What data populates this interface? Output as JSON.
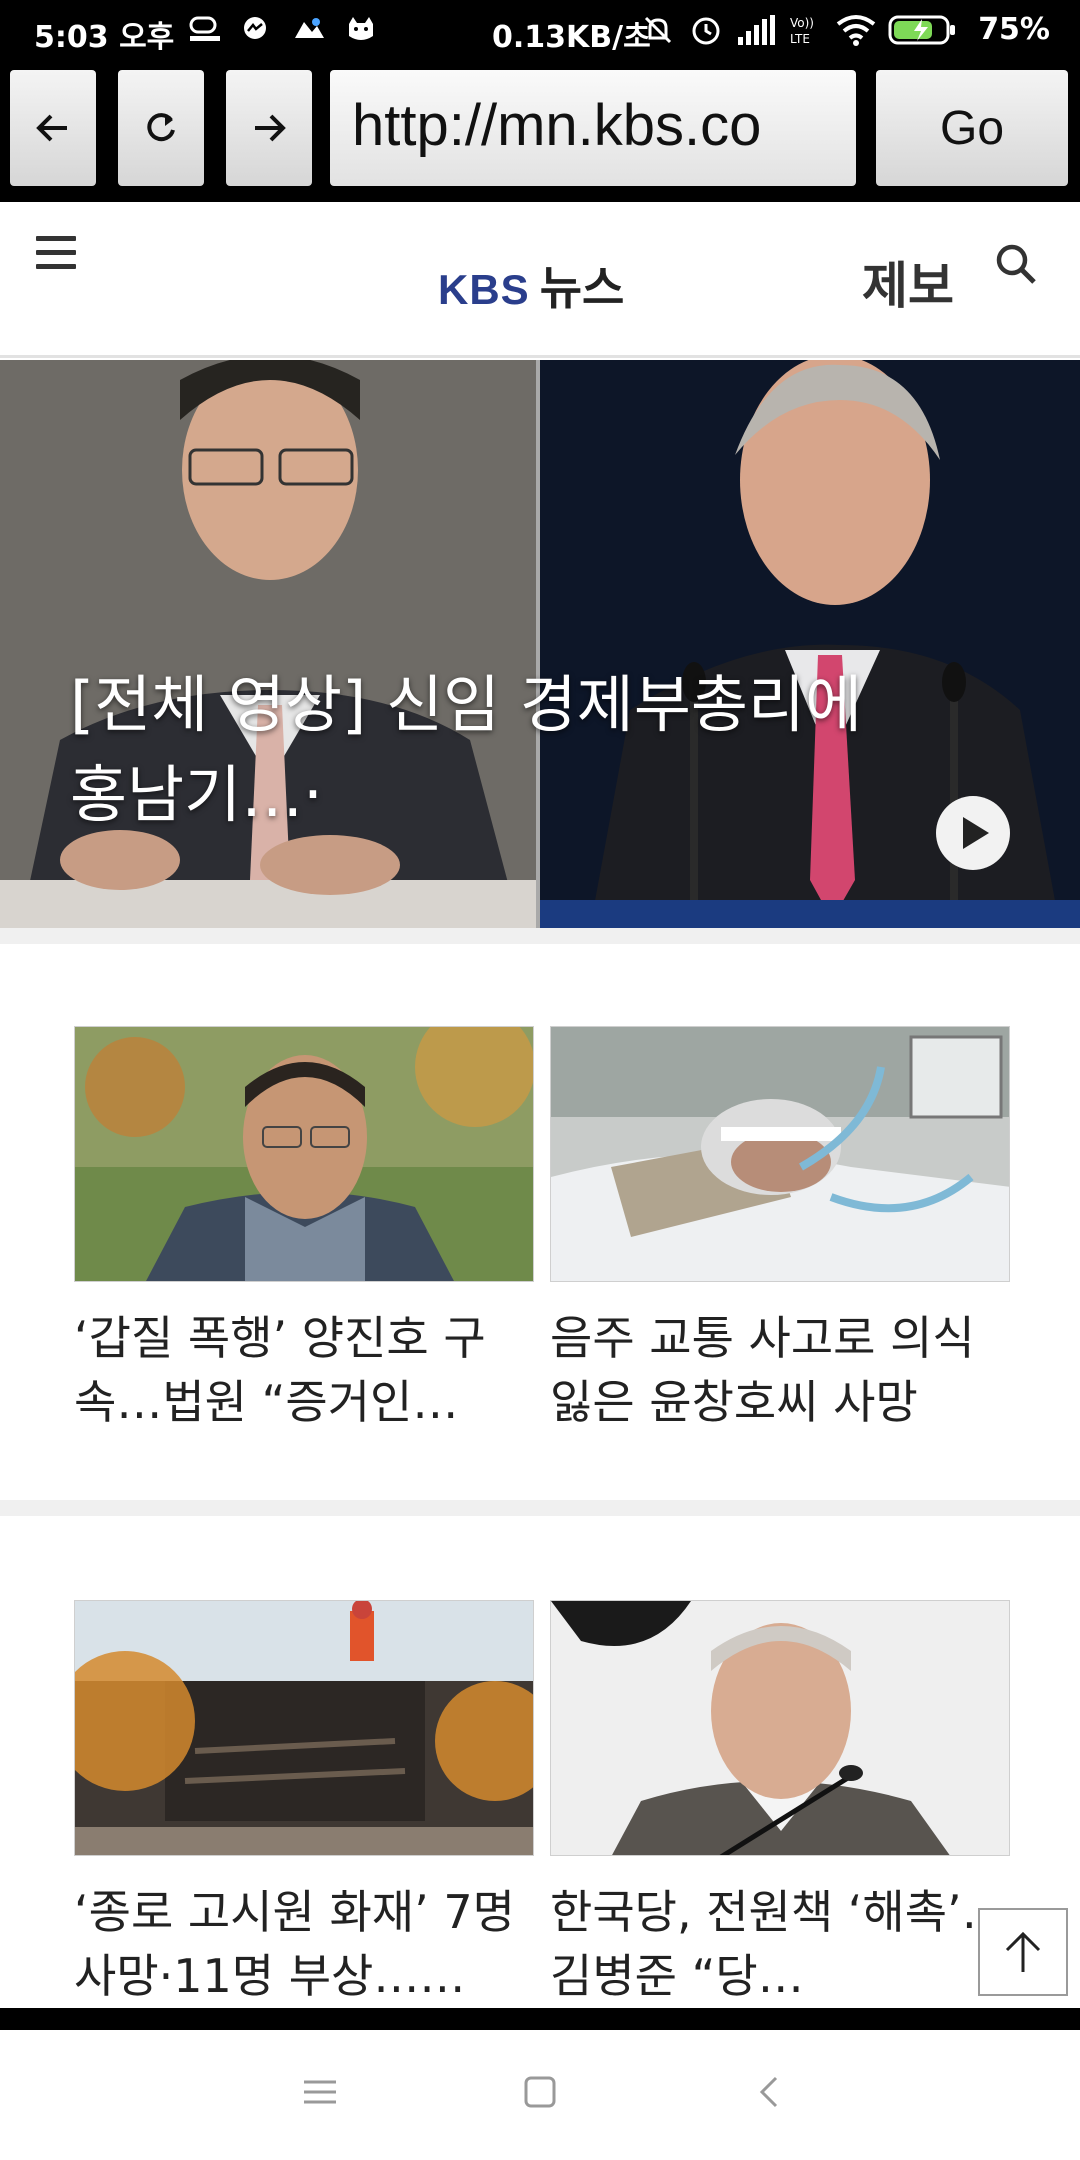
{
  "status_bar": {
    "time": "5:03 오후",
    "network_speed": "0.13KB/초",
    "battery": "75%"
  },
  "browser": {
    "back_icon": "arrow-left-icon",
    "reload_icon": "reload-icon",
    "forward_icon": "arrow-right-icon",
    "url": "http://mn.kbs.co",
    "go_label": "Go"
  },
  "header": {
    "logo_kbs": "KBS",
    "logo_news": "뉴스",
    "report_label": "제보"
  },
  "hero": {
    "title": "[전체 영상] 신임 경제부총리에 홍남기…·"
  },
  "articles": [
    {
      "headline": "‘갑질 폭행’ 양진호 구속…법원 “증거인…"
    },
    {
      "headline": "음주 교통 사고로 의식 잃은 윤창호씨 사망"
    },
    {
      "headline": "‘종로 고시원 화재’ 7명 사망·11명 부상……"
    },
    {
      "headline": "한국당, 전원책 ‘해촉’…김병준 “당…"
    }
  ],
  "colors": {
    "kbs_blue": "#2a3e8c",
    "status_bg": "#000000",
    "battery_green": "#7ed957"
  }
}
